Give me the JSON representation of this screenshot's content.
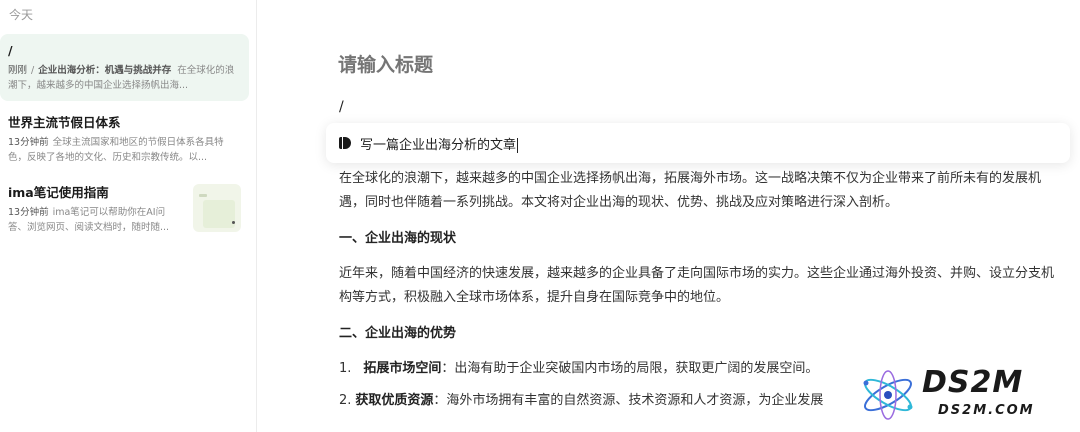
{
  "sidebar": {
    "section_label": "今天",
    "notes": [
      {
        "title": "/",
        "time": "刚刚",
        "slash": "/",
        "bold": "企业出海分析：机遇与挑战并存",
        "preview": "在全球化的浪潮下，越来越多的中国企业选择扬帆出海..."
      },
      {
        "title": "世界主流节假日体系",
        "time": "13分钟前",
        "preview": "全球主流国家和地区的节假日体系各具特色，反映了各地的文化、历史和宗教传统。以..."
      },
      {
        "title": "ima笔记使用指南",
        "time": "13分钟前",
        "preview": "ima笔记可以帮助你在AI问答、浏览网页、阅读文档时，随时随..."
      }
    ]
  },
  "editor": {
    "title_placeholder": "请输入标题",
    "slash_line": "/",
    "ai_prompt_value": "写一篇企业出海分析的文章",
    "paragraph_1": "在全球化的浪潮下，越来越多的中国企业选择扬帆出海，拓展海外市场。这一战略决策不仅为企业带来了前所未有的发展机遇，同时也伴随着一系列挑战。本文将对企业出海的现状、优势、挑战及应对策略进行深入剖析。",
    "heading_1": "一、企业出海的现状",
    "paragraph_2": "近年来，随着中国经济的快速发展，越来越多的企业具备了走向国际市场的实力。这些企业通过海外投资、并购、设立分支机构等方式，积极融入全球市场体系，提升自身在国际竞争中的地位。",
    "heading_2": "二、企业出海的优势",
    "list": [
      {
        "num": "1.",
        "label": "拓展市场空间",
        "text": "：出海有助于企业突破国内市场的局限，获取更广阔的发展空间。"
      },
      {
        "num": "2.",
        "label": "获取优质资源",
        "text": "：海外市场拥有丰富的自然资源、技术资源和人才资源，为企业发展"
      }
    ]
  },
  "watermark": {
    "main": "DS2M",
    "sub": "DS2M.COM"
  }
}
